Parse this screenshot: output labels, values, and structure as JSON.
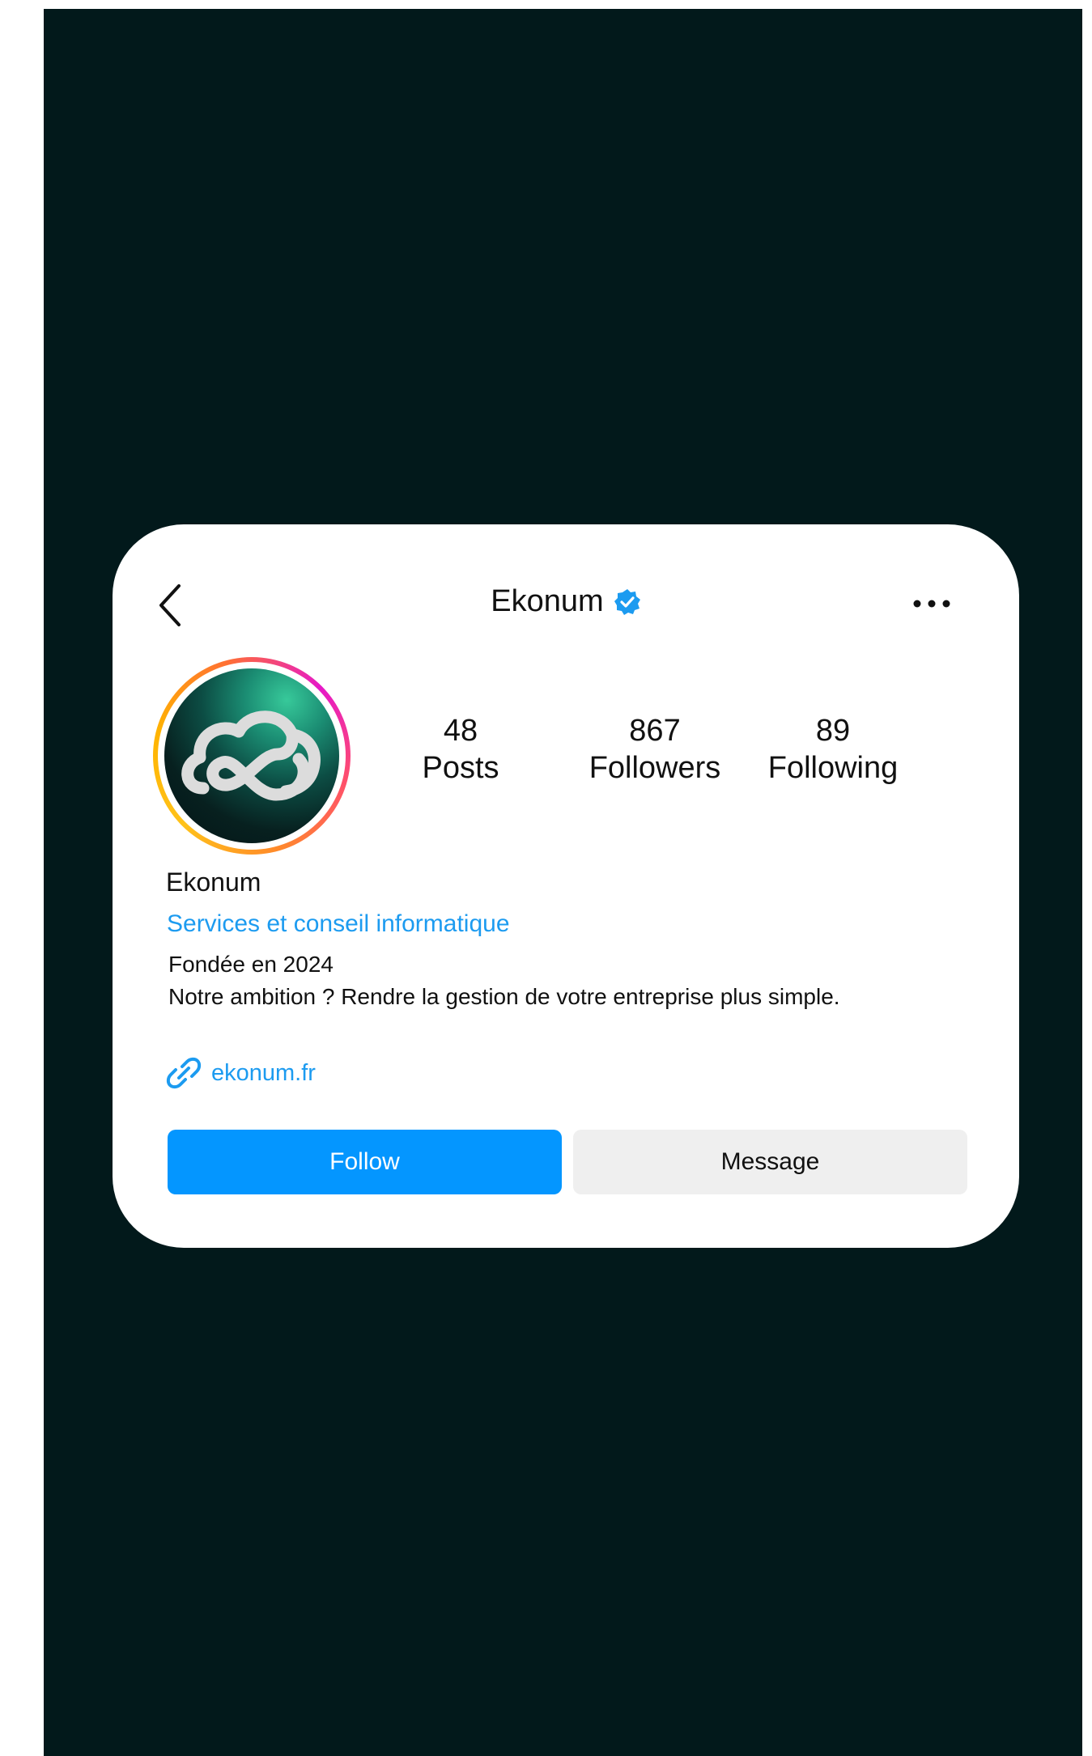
{
  "header": {
    "title": "Ekonum",
    "back_icon": "chevron-left-icon",
    "verified_icon": "verified-badge-icon",
    "more_icon": "more-horizontal-icon"
  },
  "avatar": {
    "icon": "cloud-infinity-logo",
    "ring_colors": [
      "#e619c8",
      "#ff8a2a",
      "#ffc21a"
    ]
  },
  "stats": [
    {
      "value": "48",
      "label": "Posts"
    },
    {
      "value": "867",
      "label": "Followers"
    },
    {
      "value": "89",
      "label": "Following"
    }
  ],
  "profile": {
    "name": "Ekonum",
    "category": "Services et conseil informatique",
    "bio": [
      "Fondée en 2024",
      "Notre ambition ? Rendre la gestion de votre entreprise plus simple."
    ]
  },
  "link": {
    "icon": "link-icon",
    "text": "ekonum.fr"
  },
  "actions": {
    "follow_label": "Follow",
    "message_label": "Message"
  },
  "colors": {
    "background": "#02191b",
    "accent": "#0496ff",
    "link": "#1c9bf0",
    "secondary_button": "#efefef"
  }
}
